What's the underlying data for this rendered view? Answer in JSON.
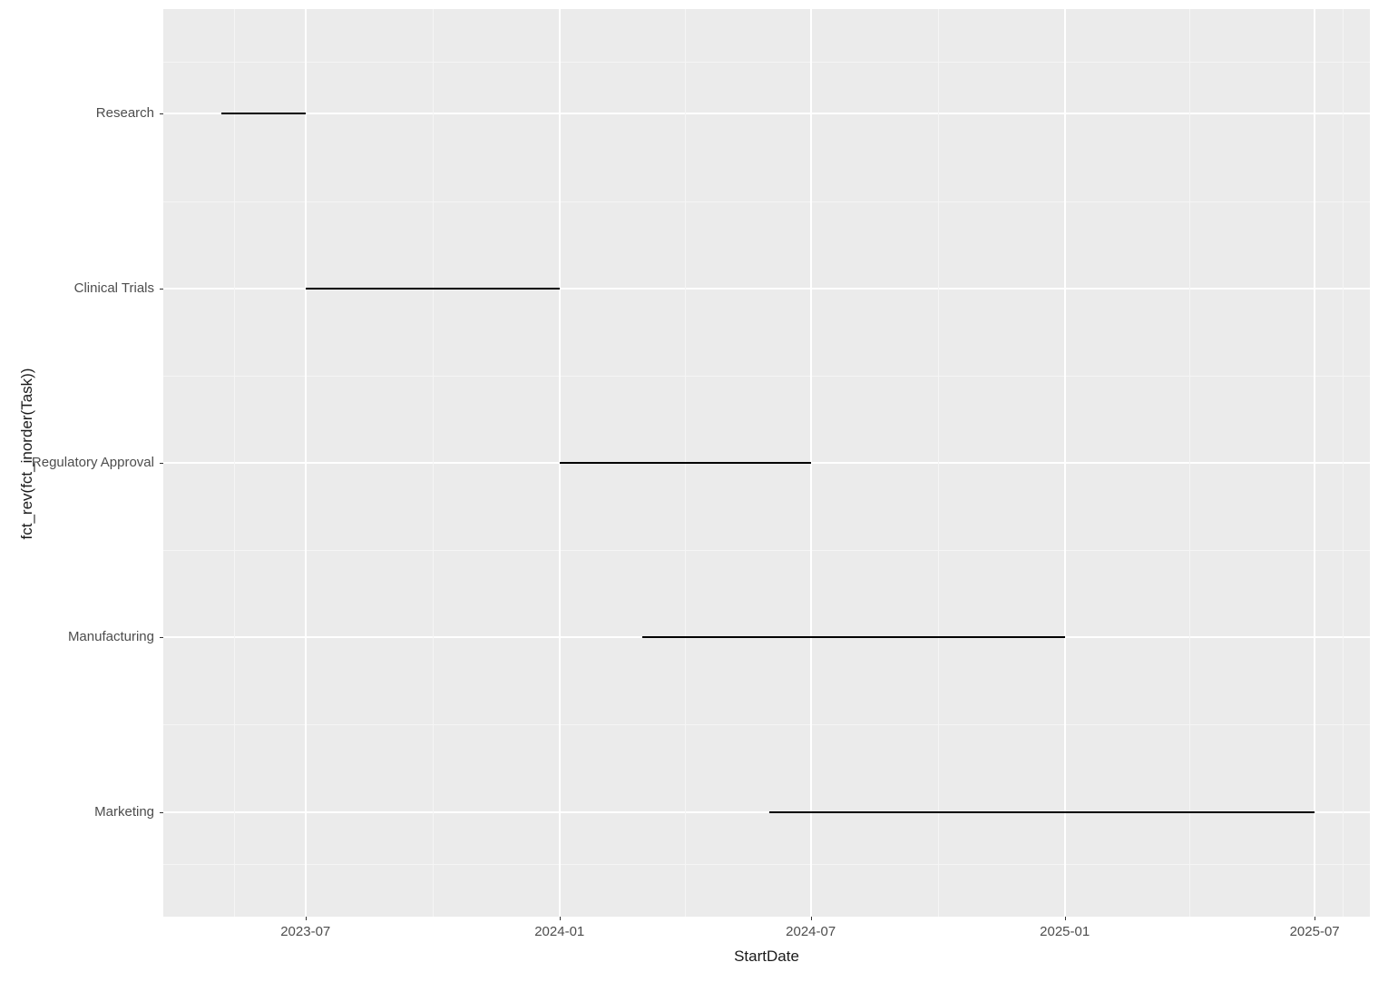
{
  "chart_data": {
    "type": "bar",
    "orientation": "horizontal-gantt",
    "tasks": [
      {
        "name": "Research",
        "start": "2023-05-01",
        "end": "2023-07-01"
      },
      {
        "name": "Clinical Trials",
        "start": "2023-07-01",
        "end": "2024-01-01"
      },
      {
        "name": "Regulatory Approval",
        "start": "2024-01-01",
        "end": "2024-07-01"
      },
      {
        "name": "Manufacturing",
        "start": "2024-03-01",
        "end": "2025-01-01"
      },
      {
        "name": "Marketing",
        "start": "2024-06-01",
        "end": "2025-07-01"
      }
    ],
    "x_breaks": [
      "2023-07",
      "2024-01",
      "2024-07",
      "2025-01",
      "2025-07"
    ],
    "x_range": [
      "2023-03-20",
      "2025-08-10"
    ],
    "xlabel": "StartDate",
    "ylabel": "fct_rev(fct_inorder(Task))",
    "background": "#ebebeb",
    "grid_major": "#ffffff",
    "bar_color": "#000000"
  }
}
